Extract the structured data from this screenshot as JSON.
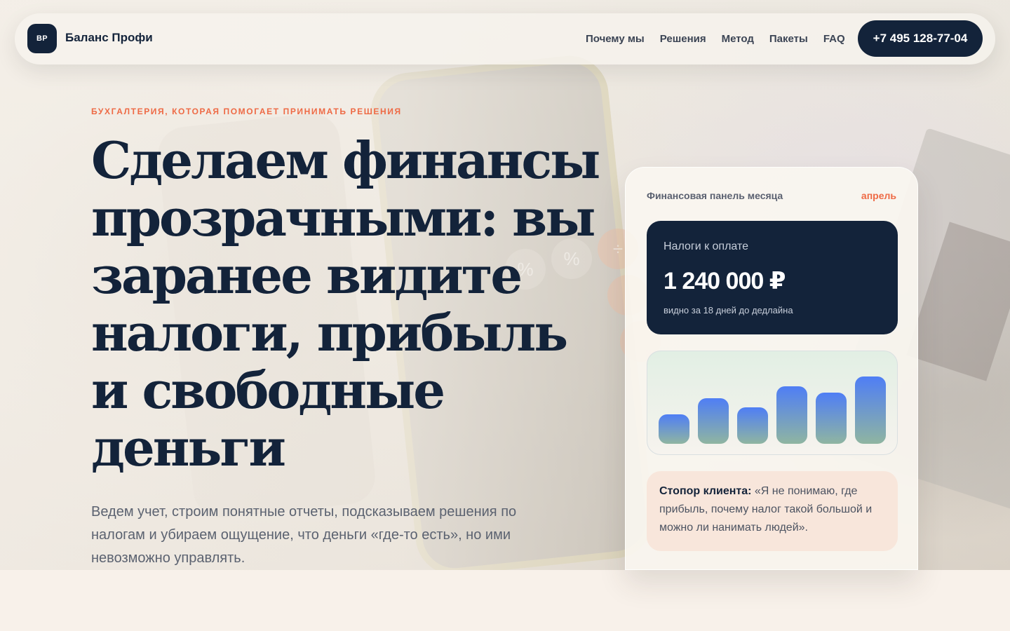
{
  "header": {
    "logo_text": "BP",
    "brand_name": "Баланс Профи",
    "nav": [
      "Почему мы",
      "Решения",
      "Метод",
      "Пакеты",
      "FAQ"
    ],
    "phone": "+7 495 128-77-04"
  },
  "hero": {
    "eyebrow": "БУХГАЛТЕРИЯ, КОТОРАЯ ПОМОГАЕТ ПРИНИМАТЬ РЕШЕНИЯ",
    "headline": "Сделаем финансы прозрачными: вы заранее видите налоги, прибыль и свободные деньги",
    "lead": "Ведем учет, строим понятные отчеты, подсказываем решения по налогам и убираем ощущение, что деньги «где-то есть», но ими невозможно управлять."
  },
  "panel": {
    "title": "Финансовая панель месяца",
    "month": "апрель",
    "tax": {
      "label": "Налоги к оплате",
      "amount": "1 240 000 ₽",
      "note": "видно за 18 дней до дедлайна"
    },
    "quote": {
      "lead": "Стопор клиента:",
      "text": " «Я не понимаю, где прибыль, почему налог такой большой и можно ли нанимать людей»."
    }
  },
  "chart_data": {
    "type": "bar",
    "values": [
      42,
      65,
      52,
      82,
      73,
      96
    ],
    "ylim": [
      0,
      100
    ],
    "bar_color_top": "#4f7ef5",
    "bar_color_bottom": "#8fb5a1"
  },
  "colors": {
    "navy": "#13233a",
    "accent": "#ee6a45"
  }
}
